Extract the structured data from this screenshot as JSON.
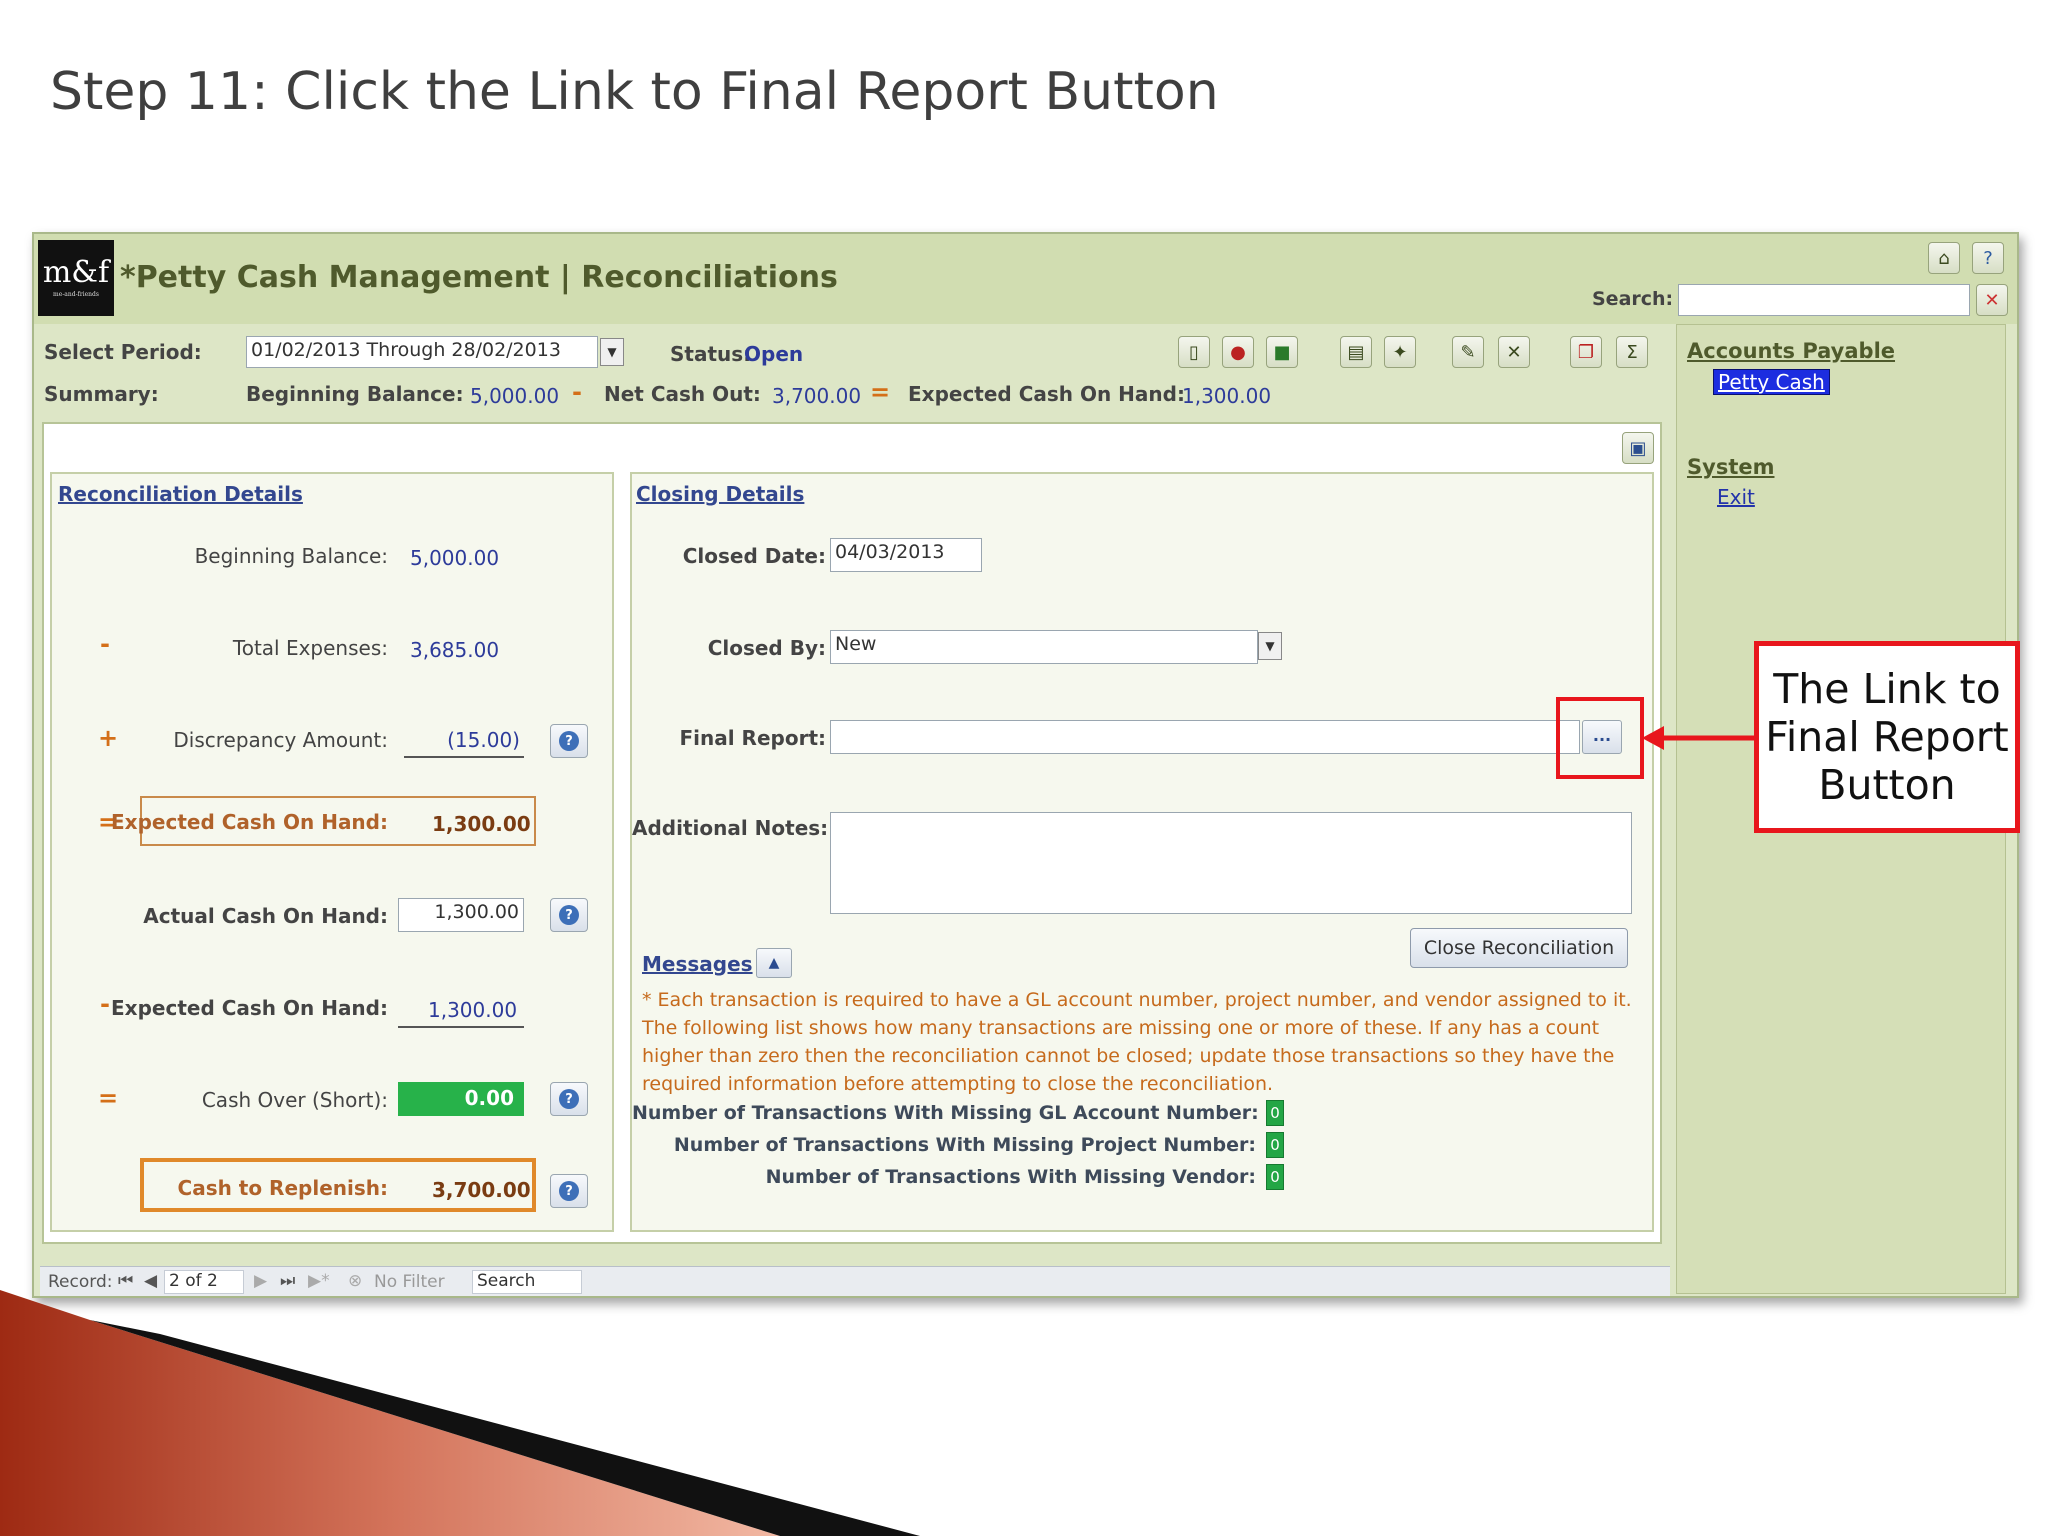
{
  "slide": {
    "title": "Step 11: Click the Link to Final Report Button",
    "callout_text": "The Link to\nFinal Report\nButton",
    "callout_color": "#e8161c"
  },
  "app": {
    "logo_text": "m&f",
    "logo_sub": "me-and-friends",
    "title": "*Petty Cash Management | Reconciliations",
    "search_label": "Search:",
    "search_value": "",
    "header_icons": [
      "home-icon",
      "help-icon"
    ]
  },
  "toolbar": {
    "select_period_label": "Select Period:",
    "select_period_value": "01/02/2013 Through 28/02/2013",
    "status_label": "Status:",
    "status_value": "Open",
    "summary_label": "Summary:",
    "beginning_balance_label": "Beginning Balance:",
    "beginning_balance_value": "5,000.00",
    "minus_op": "-",
    "net_cash_out_label": "Net Cash Out:",
    "net_cash_out_value": "3,700.00",
    "equals_op": "=",
    "expected_cash_label": "Expected Cash On Hand:",
    "expected_cash_value": "1,300.00",
    "icons": [
      "report-book-icon",
      "chart-icon",
      "spreadsheet-icon",
      "print-icon",
      "new-record-icon",
      "edit-icon",
      "delete-icon",
      "copy-icon",
      "sum-icon"
    ]
  },
  "reconciliation": {
    "title": "Reconciliation Details",
    "rows": [
      {
        "op": "",
        "label": "Beginning Balance:",
        "value": "5,000.00"
      },
      {
        "op": "-",
        "label": "Total Expenses:",
        "value": "3,685.00"
      },
      {
        "op": "+",
        "label": "Discrepancy Amount:",
        "value": "(15.00)"
      },
      {
        "op": "=",
        "label": "Expected Cash On Hand:",
        "value": "1,300.00"
      },
      {
        "op": "",
        "label": "Actual Cash On Hand:",
        "value": "1,300.00"
      },
      {
        "op": "-",
        "label": "Expected Cash On Hand:",
        "value": "1,300.00"
      },
      {
        "op": "=",
        "label": "Cash Over (Short):",
        "value": "0.00"
      },
      {
        "op": "",
        "label": "Cash to Replenish:",
        "value": "3,700.00"
      }
    ]
  },
  "closing": {
    "title": "Closing Details",
    "closed_date_label": "Closed Date:",
    "closed_date_value": "04/03/2013",
    "closed_by_label": "Closed By:",
    "closed_by_value": "New",
    "final_report_label": "Final Report:",
    "final_report_value": "",
    "browse_button": "...",
    "additional_notes_label": "Additional Notes:",
    "additional_notes_value": "",
    "close_button": "Close Reconciliation"
  },
  "messages": {
    "title": "Messages",
    "text": "* Each transaction is required to have a GL account number, project number, and vendor assigned to it.  The following list shows how many transactions are missing one or more of these.  If any has a count higher than zero then the reconciliation cannot be closed; update those transactions so they have the required information before attempting to close the reconciliation.",
    "counts": [
      {
        "label": "Number of Transactions With Missing GL Account Number:",
        "value": "0"
      },
      {
        "label": "Number of Transactions With Missing Project Number:",
        "value": "0"
      },
      {
        "label": "Number of Transactions With Missing Vendor:",
        "value": "0"
      }
    ]
  },
  "nav": {
    "section1": "Accounts Payable",
    "item1": "Petty Cash",
    "section2": "System",
    "item2": "Exit"
  },
  "record_bar": {
    "label": "Record:",
    "position": "2 of 2",
    "filter": "No Filter",
    "search": "Search"
  }
}
